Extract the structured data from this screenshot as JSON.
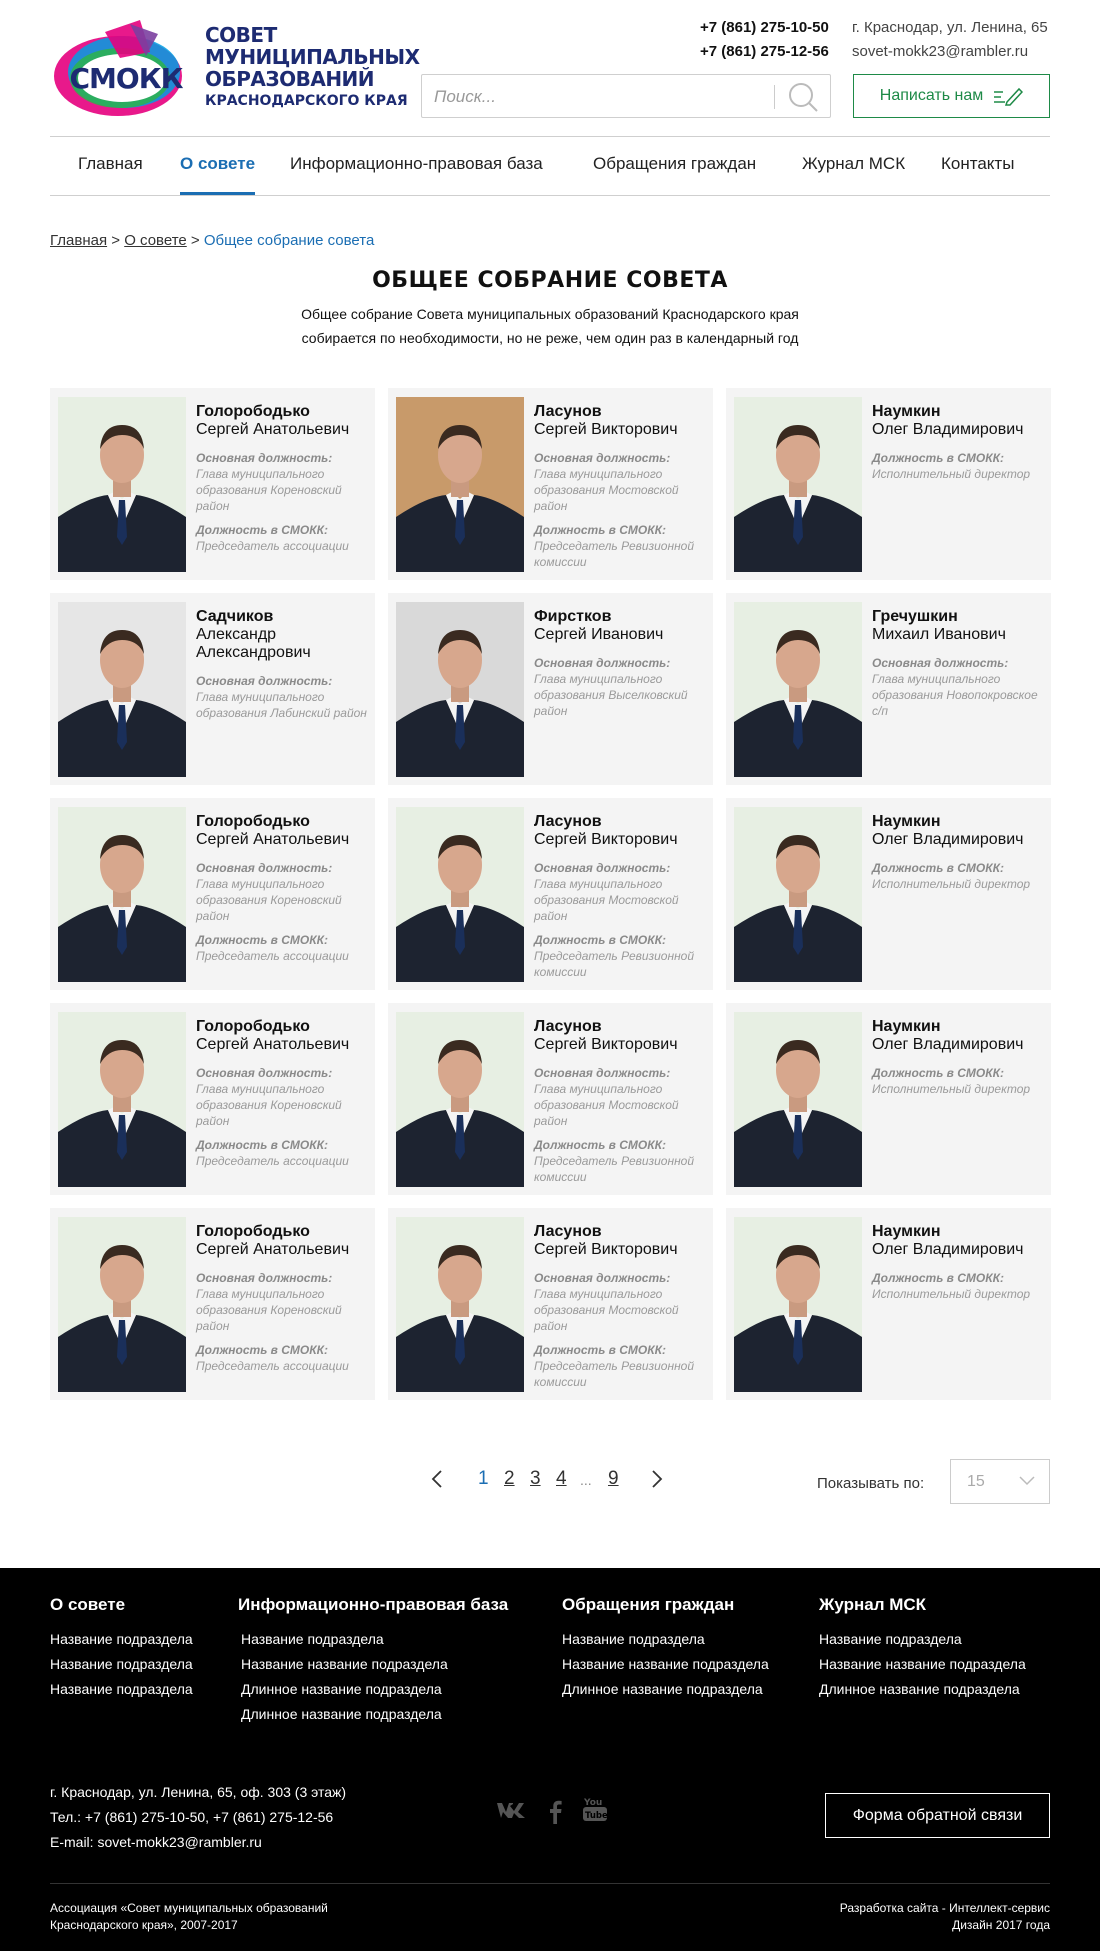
{
  "header": {
    "logo_abbr": "СМОКК",
    "logo_lines": [
      "СОВЕТ",
      "МУНИЦИПАЛЬНЫХ",
      "ОБРАЗОВАНИЙ",
      "КРАСНОДАРСКОГО КРАЯ"
    ],
    "phone1": "+7 (861) 275-10-50",
    "phone2": "+7 (861) 275-12-56",
    "address": "г. Краснодар, ул. Ленина, 65",
    "email": "sovet-mokk23@rambler.ru",
    "search_placeholder": "Поиск...",
    "write_button": "Написать нам"
  },
  "nav": [
    "Главная",
    "О совете",
    "Информационно-правовая база",
    "Обращения граждан",
    "Журнал МСК",
    "Контакты"
  ],
  "breadcrumb": {
    "home": "Главная",
    "section": "О совете",
    "current": "Общее собрание совета",
    "sep": ">"
  },
  "page": {
    "title": "ОБЩЕЕ СОБРАНИЕ СОВЕТА",
    "lead_line1": "Общее собрание Совета муниципальных образований Краснодарского края",
    "lead_line2": "собирается по необходимости, но не реже, чем один раз в календарный год"
  },
  "labels": {
    "main_position": "Основная должность:",
    "smokk_position": "Должность в СМОКК:"
  },
  "members": [
    {
      "last": "Голорободько",
      "first": "Сергей Анатольевич",
      "main": "Глава муниципального образования Кореновский район",
      "smokk": "Председатель ассоциации"
    },
    {
      "last": "Ласунов",
      "first": "Сергей Викторович",
      "main": "Глава муниципального образования Мостовской район",
      "smokk": "Председатель Ревизионной комиссии"
    },
    {
      "last": "Наумкин",
      "first": "Олег Владимирович",
      "main": "",
      "smokk": "Исполнительный директор"
    },
    {
      "last": "Садчиков",
      "first": "Александр Александрович",
      "main": "Глава муниципального образования Лабинский район",
      "smokk": ""
    },
    {
      "last": "Фирстков",
      "first": "Сергей Иванович",
      "main": "Глава муниципального образования Выселковский район",
      "smokk": ""
    },
    {
      "last": "Гречушкин",
      "first": "Михаил Иванович",
      "main": "Глава муниципального образования Новопокровское с/п",
      "smokk": ""
    },
    {
      "last": "Голорободько",
      "first": "Сергей Анатольевич",
      "main": "Глава муниципального образования Кореновский район",
      "smokk": "Председатель ассоциации"
    },
    {
      "last": "Ласунов",
      "first": "Сергей Викторович",
      "main": "Глава муниципального образования Мостовской район",
      "smokk": "Председатель Ревизионной комиссии"
    },
    {
      "last": "Наумкин",
      "first": "Олег Владимирович",
      "main": "",
      "smokk": "Исполнительный директор"
    },
    {
      "last": "Голорободько",
      "first": "Сергей Анатольевич",
      "main": "Глава муниципального образования Кореновский район",
      "smokk": "Председатель ассоциации"
    },
    {
      "last": "Ласунов",
      "first": "Сергей Викторович",
      "main": "Глава муниципального образования Мостовской район",
      "smokk": "Председатель Ревизионной комиссии"
    },
    {
      "last": "Наумкин",
      "first": "Олег Владимирович",
      "main": "",
      "smokk": "Исполнительный директор"
    },
    {
      "last": "Голорободько",
      "first": "Сергей Анатольевич",
      "main": "Глава муниципального образования Кореновский район",
      "smokk": "Председатель ассоциации"
    },
    {
      "last": "Ласунов",
      "first": "Сергей Викторович",
      "main": "Глава муниципального образования Мостовской район",
      "smokk": "Председатель Ревизионной комиссии"
    },
    {
      "last": "Наумкин",
      "first": "Олег Владимирович",
      "main": "",
      "smokk": "Исполнительный директор"
    }
  ],
  "pagination": {
    "pages": [
      "1",
      "2",
      "3",
      "4",
      "...",
      "9"
    ],
    "current": "1",
    "show_label": "Показывать по:",
    "per_page": "15"
  },
  "footer": {
    "columns": [
      {
        "title": "О совете",
        "links": [
          "Название подраздела",
          "Название подраздела",
          "Название подраздела"
        ]
      },
      {
        "title": "Информационно-правовая база",
        "links": [
          "Название подраздела",
          "Название название подраздела",
          "Длинное название подраздела",
          "Длинное название подраздела"
        ]
      },
      {
        "title": "Обращения граждан",
        "links": [
          "Название подраздела",
          "Название название подраздела",
          "Длинное название подраздела"
        ]
      },
      {
        "title": "Журнал МСК",
        "links": [
          "Название подраздела",
          "Название название подраздела",
          "Длинное название подраздела"
        ]
      }
    ],
    "address": "г. Краснодар, ул. Ленина, 65, оф. 303 (3 этаж)",
    "phones": "Тел.: +7 (861) 275-10-50,  +7 (861) 275-12-56",
    "email_label": "E-mail:",
    "email": "sovet-mokk23@rambler.ru",
    "feedback_button": "Форма обратной связи",
    "copyright_line1": "Ассоциация «Совет муниципальных образований",
    "copyright_line2": "Краснодарского края», 2007-2017",
    "dev_prefix": "Разработка сайта - ",
    "dev_link": "Интеллект-сервис",
    "design_year": "Дизайн 2017 года",
    "social": [
      "vk-icon",
      "facebook-icon",
      "youtube-icon"
    ]
  },
  "colors": {
    "accent": "#1b6eb3",
    "green": "#1e8a47",
    "footer_bg": "#000000",
    "card_bg": "#f4f4f4"
  }
}
